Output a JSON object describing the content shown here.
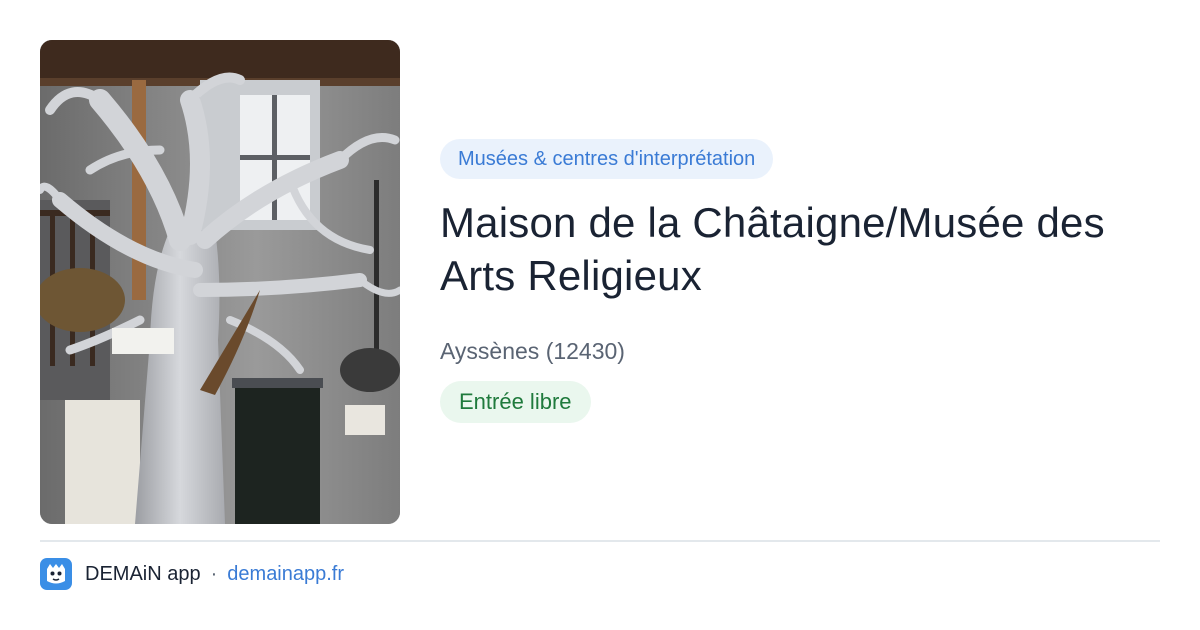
{
  "photo": {
    "subject": "white painted sculpted tree inside museum room with window and hanging baskets"
  },
  "category": "Musées & centres d'interprétation",
  "title": "Maison de la Châtaigne/Musée des Arts Religieux",
  "location": "Ayssènes (12430)",
  "entry_status": "Entrée libre",
  "footer": {
    "app_icon": "demain-app-logo-icon",
    "app_name": "DEMAiN app",
    "separator": "·",
    "domain": "demainapp.fr"
  },
  "colors": {
    "category_bg": "#eaf2fc",
    "category_text": "#3a7bd5",
    "status_bg": "#eaf7ee",
    "status_text": "#1f7a3c",
    "app_icon_bg": "#3a8ee6"
  }
}
